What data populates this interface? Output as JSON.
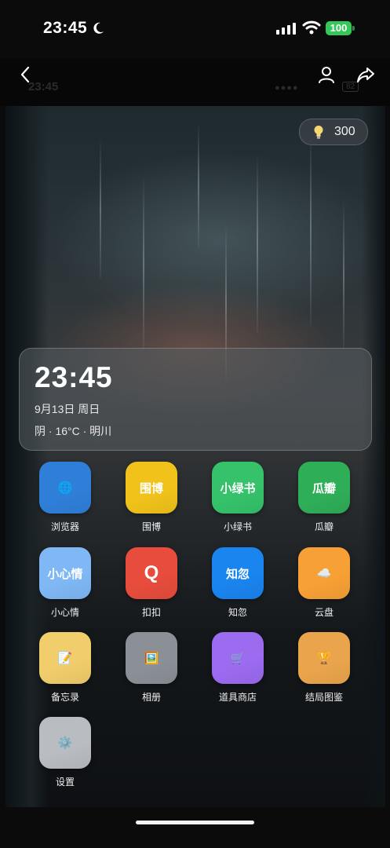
{
  "status_bar": {
    "time": "23:45",
    "battery": "100"
  },
  "nav": {
    "ghost_time": "23:45",
    "ghost_dots": "●●●●",
    "ghost_battery": "82"
  },
  "hint": {
    "count": "300"
  },
  "widget": {
    "time": "23:45",
    "date": "9月13日 周日",
    "weather": "阴 · 16°C · 明川"
  },
  "apps": [
    {
      "label": "浏览器",
      "glyph": "🌐",
      "color": "#2f7fd9",
      "icon": "globe-icon"
    },
    {
      "label": "围博",
      "glyph": "围博",
      "color": "#f0c21a",
      "icon": "weibo-icon"
    },
    {
      "label": "小绿书",
      "glyph": "小绿书",
      "color": "#35c26a",
      "icon": "green-book-icon"
    },
    {
      "label": "瓜瓣",
      "glyph": "瓜瓣",
      "color": "#2fae58",
      "icon": "guaban-icon"
    },
    {
      "label": "小心情",
      "glyph": "小心情",
      "color": "#7fb8f5",
      "icon": "mood-icon"
    },
    {
      "label": "扣扣",
      "glyph": "Q",
      "color": "#e74c3c",
      "icon": "qq-icon"
    },
    {
      "label": "知忽",
      "glyph": "知忽",
      "color": "#1a84ef",
      "icon": "zhihu-icon"
    },
    {
      "label": "云盘",
      "glyph": "☁️",
      "color": "#f7a035",
      "icon": "cloud-icon"
    },
    {
      "label": "备忘录",
      "glyph": "📝",
      "color": "#f1cd6b",
      "icon": "memo-icon"
    },
    {
      "label": "相册",
      "glyph": "🖼️",
      "color": "#8b9096",
      "icon": "photo-icon"
    },
    {
      "label": "道具商店",
      "glyph": "🛒",
      "color": "#9b6bf0",
      "icon": "cart-icon"
    },
    {
      "label": "结局图鉴",
      "glyph": "🏆",
      "color": "#eaa54c",
      "icon": "trophy-icon"
    },
    {
      "label": "设置",
      "glyph": "⚙️",
      "color": "#b9bcc1",
      "icon": "settings-icon"
    }
  ]
}
